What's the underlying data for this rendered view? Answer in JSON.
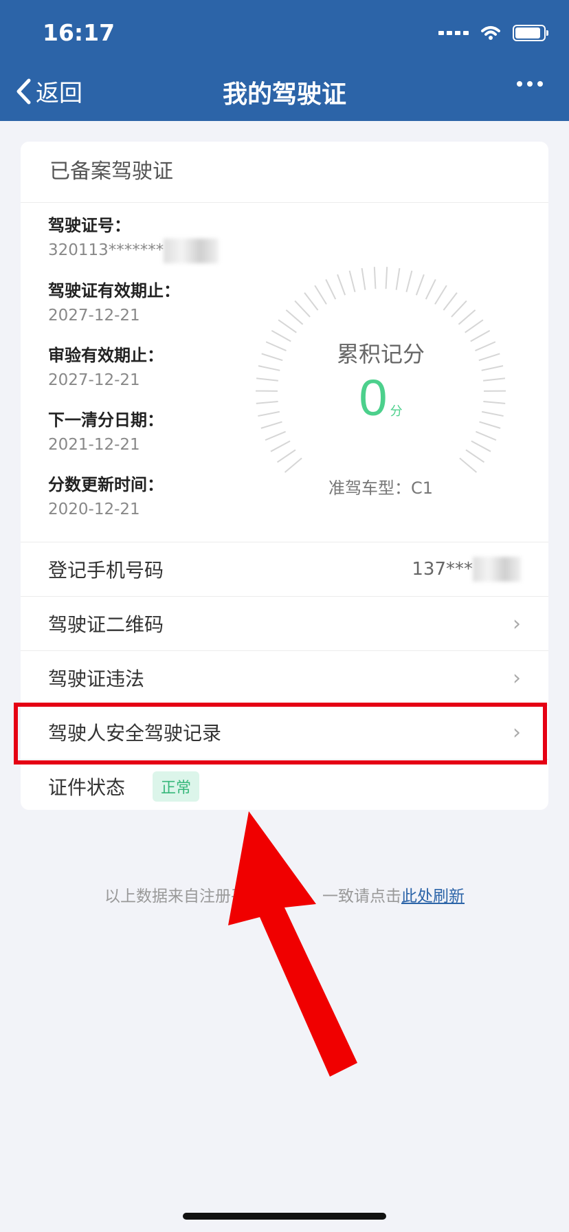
{
  "status_bar": {
    "time": "16:17"
  },
  "nav": {
    "back_label": "返回",
    "title": "我的驾驶证"
  },
  "card": {
    "title": "已备案驾驶证",
    "info": [
      {
        "label": "驾驶证号：",
        "value": "320113*******"
      },
      {
        "label": "驾驶证有效期止：",
        "value": "2027-12-21"
      },
      {
        "label": "审验有效期止：",
        "value": "2027-12-21"
      },
      {
        "label": "下一清分日期：",
        "value": "2021-12-21"
      },
      {
        "label": "分数更新时间：",
        "value": "2020-12-21"
      }
    ],
    "score": {
      "label": "累积记分",
      "value": "0",
      "unit": "分",
      "vehicle_type": "准驾车型：C1"
    }
  },
  "rows": {
    "phone": {
      "label": "登记手机号码",
      "value": "137***"
    },
    "qrcode": {
      "label": "驾驶证二维码"
    },
    "violation": {
      "label": "驾驶证违法"
    },
    "safety_record": {
      "label": "驾驶人安全驾驶记录"
    },
    "status": {
      "label": "证件状态",
      "badge": "正常"
    }
  },
  "footer": {
    "text": "以上数据来自注册平",
    "text2": "一致请点击",
    "link": "此处刷新"
  },
  "colors": {
    "header": "#2c64a8",
    "accent_green": "#4cd08c",
    "highlight_red": "#e50014"
  },
  "icons": [
    "chevron-left-icon",
    "more-icon",
    "chevron-right-icon",
    "signal-icon",
    "wifi-icon",
    "battery-icon"
  ]
}
